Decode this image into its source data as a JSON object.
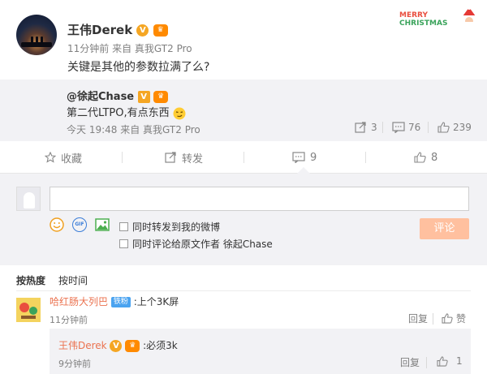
{
  "post": {
    "author": "王伟Derek",
    "time": "11分钟前",
    "source": "来自 真我GT2 Pro",
    "text": "关键是其他的参数拉满了么?",
    "decoration": {
      "line1": "MERRY",
      "line2": "CHRISTMAS"
    }
  },
  "repost": {
    "author": "@徐起Chase",
    "text": "第二代LTPO,有点东西",
    "time": "今天 19:48",
    "source": "来自 真我GT2 Pro",
    "forwards": "3",
    "comments": "76",
    "likes": "239"
  },
  "actions": {
    "favorite": "收藏",
    "forward": "转发",
    "comment_count": "9",
    "like_count": "8"
  },
  "composer": {
    "input_placeholder": "",
    "gif_label": "GIF",
    "option1": "同时转发到我的微博",
    "option2": "同时评论给原文作者 徐起Chase",
    "submit": "评论"
  },
  "tabs": [
    "按热度",
    "按时间"
  ],
  "comments": [
    {
      "author": "哈红肠大列巴",
      "badge": "铁粉",
      "text": ":上个3K屏",
      "time": "11分钟前",
      "reply": "回复",
      "like": "赞"
    }
  ],
  "reply": {
    "author": "王伟Derek",
    "text": ":必须3k",
    "time": "9分钟前",
    "reply": "回复",
    "like_count": "1"
  },
  "colors": {
    "accent": "#eb7350",
    "submit_disabled": "#ffc09f",
    "panel": "#f2f2f5"
  }
}
